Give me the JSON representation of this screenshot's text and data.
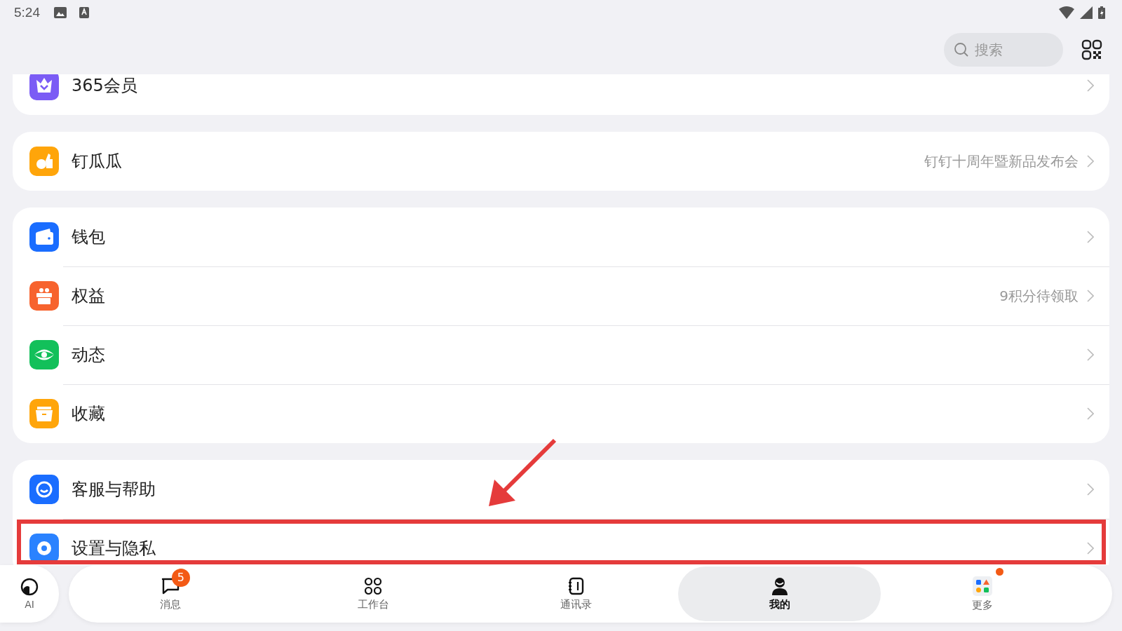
{
  "status_bar": {
    "time": "5:24"
  },
  "header": {
    "search": {
      "placeholder": "搜索"
    }
  },
  "groups": [
    {
      "items": [
        {
          "kind": "crown",
          "color": "#7b5cf5",
          "label": "365会员"
        }
      ]
    },
    {
      "items": [
        {
          "kind": "thumb",
          "color": "#ffa50a",
          "label": "钉瓜瓜",
          "detail": "钉钉十周年暨新品发布会"
        }
      ]
    },
    {
      "items": [
        {
          "kind": "wallet",
          "color": "#1a6dff",
          "label": "钱包"
        },
        {
          "kind": "gift",
          "color": "#f7632e",
          "label": "权益",
          "detail": "9积分待领取"
        },
        {
          "kind": "eye",
          "color": "#12c05a",
          "label": "动态"
        },
        {
          "kind": "folder",
          "color": "#ffa50a",
          "label": "收藏"
        }
      ]
    },
    {
      "items": [
        {
          "kind": "headset",
          "color": "#1a6dff",
          "label": "客服与帮助"
        },
        {
          "kind": "gear",
          "color": "#2a82ff",
          "label": "设置与隐私"
        }
      ]
    }
  ],
  "ai_button": {
    "label": "AI"
  },
  "nav": [
    {
      "kind": "chat",
      "label": "消息",
      "selected": false,
      "badge": "5"
    },
    {
      "kind": "grid",
      "label": "工作台",
      "selected": false
    },
    {
      "kind": "book",
      "label": "通讯录",
      "selected": false
    },
    {
      "kind": "person",
      "label": "我的",
      "selected": true
    },
    {
      "kind": "apps",
      "label": "更多",
      "selected": false,
      "dot": true
    }
  ]
}
